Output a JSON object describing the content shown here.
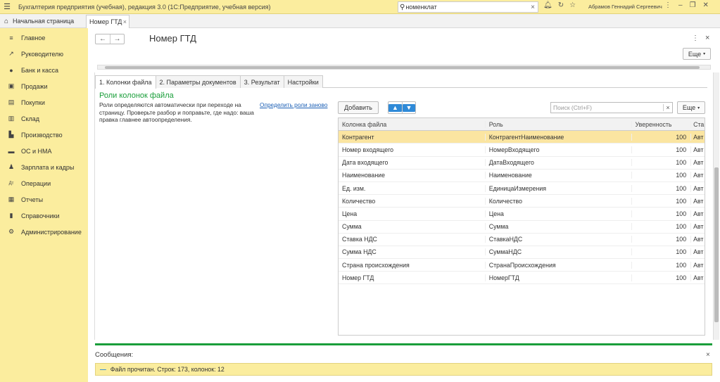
{
  "app": {
    "title": "Бухгалтерия предприятия (учебная), редакция 3.0  (1С:Предприятие, учебная версия)",
    "search_value": "номенклат",
    "user": "Абрамов Геннадий Сергеевич"
  },
  "tabs": {
    "home": "Начальная страница",
    "current": "Номер ГТД"
  },
  "sidebar": {
    "items": [
      {
        "label": "Главное",
        "icon": "menu-icon"
      },
      {
        "label": "Руководителю",
        "icon": "chart-line-icon"
      },
      {
        "label": "Банк и касса",
        "icon": "coin-icon"
      },
      {
        "label": "Продажи",
        "icon": "shopping-bag-icon"
      },
      {
        "label": "Покупки",
        "icon": "cart-icon"
      },
      {
        "label": "Склад",
        "icon": "warehouse-icon"
      },
      {
        "label": "Производство",
        "icon": "factory-icon"
      },
      {
        "label": "ОС и НМА",
        "icon": "truck-icon"
      },
      {
        "label": "Зарплата и кадры",
        "icon": "person-icon"
      },
      {
        "label": "Операции",
        "icon": "dt-kt-icon"
      },
      {
        "label": "Отчеты",
        "icon": "report-icon"
      },
      {
        "label": "Справочники",
        "icon": "book-icon"
      },
      {
        "label": "Администрирование",
        "icon": "gear-icon"
      }
    ]
  },
  "form": {
    "title": "Номер ГТД",
    "more_label": "Еще",
    "inner_tabs": [
      "1. Колонки файла",
      "2. Параметры документов",
      "3. Результат",
      "Настройки"
    ],
    "section_title": "Роли колонок файла",
    "description": "Роли определяются автоматически при переходе на страницу. Проверьте разбор и поправьте, где надо: ваша правка главнее автоопределения.",
    "redefine_link": "Определить роли заново",
    "add_label": "Добавить",
    "search_placeholder": "Поиск (Ctrl+F)",
    "more2_label": "Еще"
  },
  "table": {
    "headers": [
      "Колонка файла",
      "Роль",
      "Уверенность",
      "Ста"
    ],
    "rows": [
      [
        "Контрагент",
        "КонтрагентНаименование",
        "100",
        "Авт"
      ],
      [
        "Номер входящего",
        "НомерВходящего",
        "100",
        "Авт"
      ],
      [
        "Дата входящего",
        "ДатаВходящего",
        "100",
        "Авт"
      ],
      [
        "Наименование",
        "Наименование",
        "100",
        "Авт"
      ],
      [
        "Ед. изм.",
        "ЕдиницаИзмерения",
        "100",
        "Авт"
      ],
      [
        "Количество",
        "Количество",
        "100",
        "Авт"
      ],
      [
        "Цена",
        "Цена",
        "100",
        "Авт"
      ],
      [
        "Сумма",
        "Сумма",
        "100",
        "Авт"
      ],
      [
        "Ставка НДС",
        "СтавкаНДС",
        "100",
        "Авт"
      ],
      [
        "Сумма НДС",
        "СуммаНДС",
        "100",
        "Авт"
      ],
      [
        "Страна происхождения",
        "СтранаПроисхождения",
        "100",
        "Авт"
      ],
      [
        "Номер ГТД",
        "НомерГТД",
        "100",
        "Авт"
      ]
    ]
  },
  "messages": {
    "title": "Сообщения:",
    "text": "Файл прочитан. Строк: 173, колонок: 12"
  },
  "colors": {
    "sidebar_bg": "#fbed9e",
    "accent_green": "#1a9e3a",
    "selected_row": "#fbe5a1",
    "link": "#1b5fb5"
  }
}
